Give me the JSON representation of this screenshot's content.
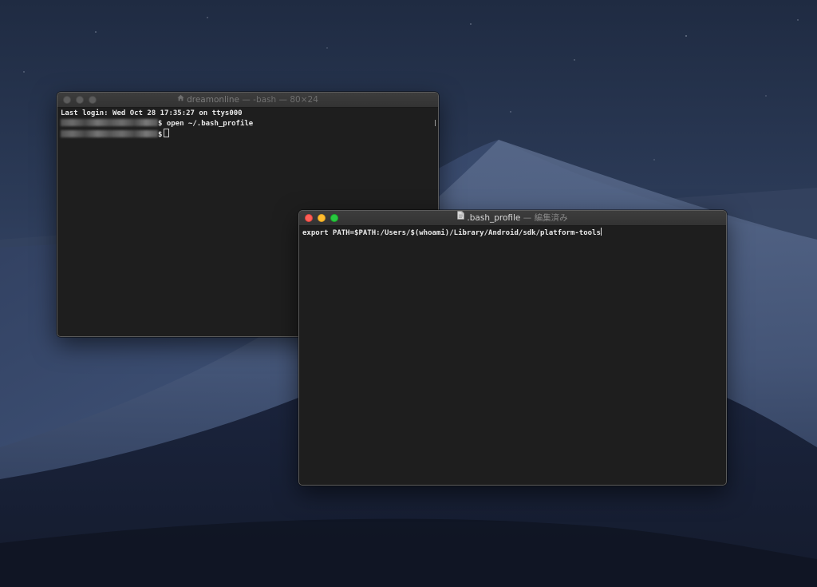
{
  "terminal_window": {
    "title_user": "dreamonline",
    "title_rest": " — -bash — 80×24",
    "lines": {
      "last_login": "Last login: Wed Oct 28 17:35:27 on ttys000",
      "prompt_symbol": "$",
      "command": " open ~/.bash_profile"
    }
  },
  "editor_window": {
    "filename": ".bash_profile",
    "status": " — 編集済み",
    "content_line": "export PATH=$PATH:/Users/$(whoami)/Library/Android/sdk/platform-tools"
  },
  "colors": {
    "close": "#fe5f57",
    "minimize": "#febc2e",
    "maximize": "#28c840",
    "terminal_bg": "#1e1e1e"
  },
  "icons": {
    "terminal_title": "home-icon",
    "editor_title": "document-icon"
  }
}
